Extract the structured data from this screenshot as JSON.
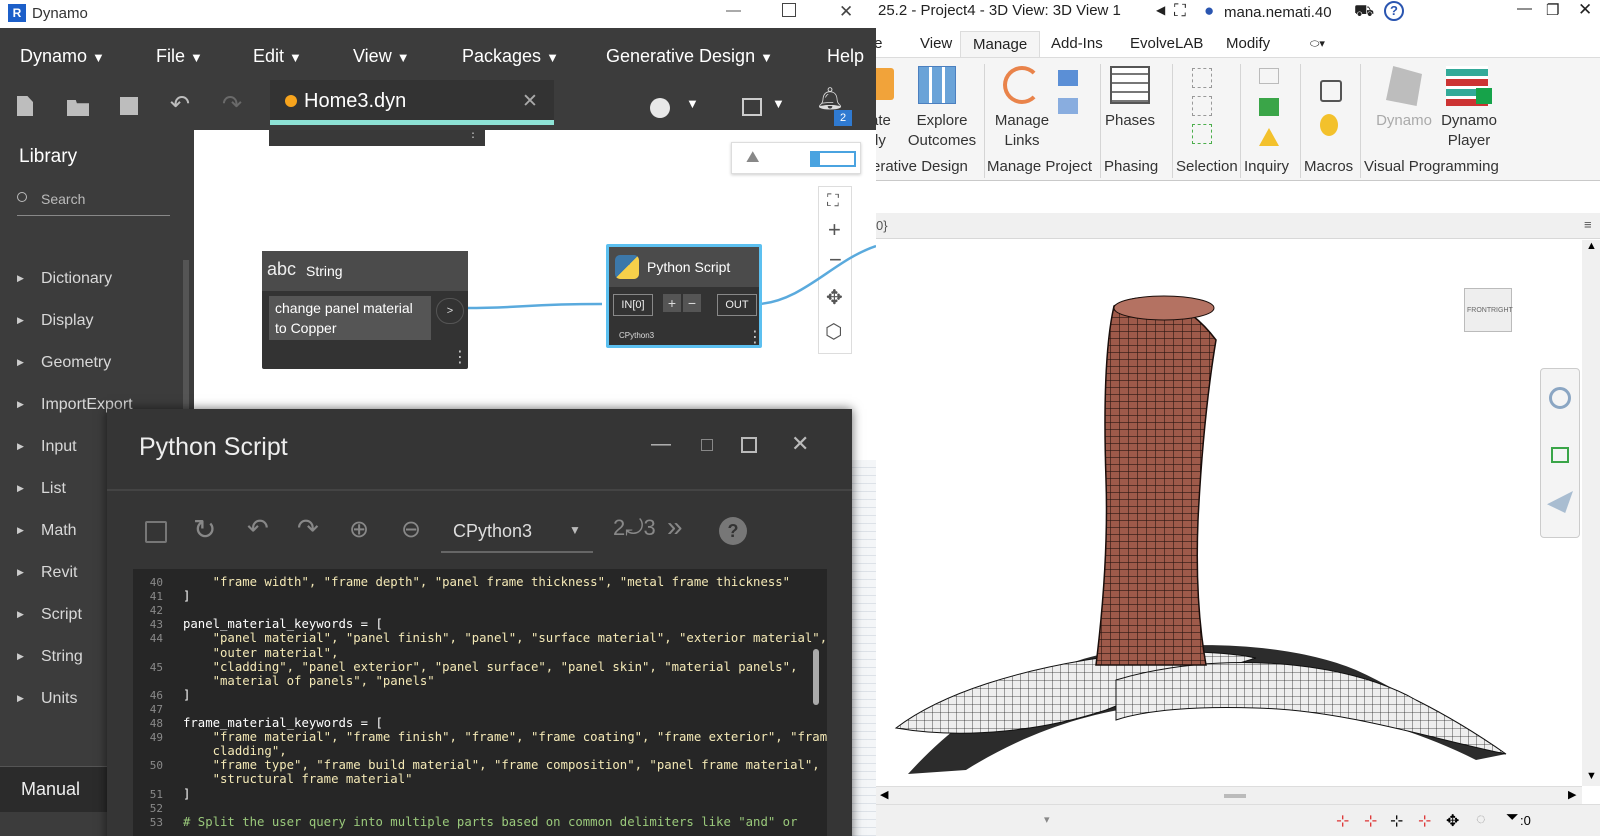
{
  "revit": {
    "title": "25.2 - Project4 - 3D View: 3D View 1",
    "user": "mana.nemati.40",
    "tabs": [
      "te",
      "View",
      "Manage",
      "Add-Ins",
      "EvolveLAB",
      "Modify"
    ],
    "active_tab": "Manage",
    "ribbon": {
      "items": [
        {
          "label": "ate\ndy"
        },
        {
          "label": "Explore\nOutcomes"
        },
        {
          "label": "Manage\nLinks"
        },
        {
          "label": "Phases"
        },
        {
          "label": "Dynamo"
        },
        {
          "label": "Dynamo\nPlayer"
        }
      ],
      "groups": [
        "erative Design",
        "Manage Project",
        "Phasing",
        "Selection",
        "Inquiry",
        "Macros",
        "Visual Programming"
      ]
    },
    "view_header": "0}",
    "viewcube": {
      "front": "FRONT",
      "right": "RIGHT"
    },
    "status_filter_count": ":0"
  },
  "dynamo": {
    "window_title": "Dynamo",
    "menu": [
      "Dynamo",
      "File",
      "Edit",
      "View",
      "Packages",
      "Generative Design",
      "Help"
    ],
    "tab_name": "Home3.dyn",
    "notification_count": "2",
    "library": {
      "title": "Library",
      "search_placeholder": "Search",
      "items": [
        "Dictionary",
        "Display",
        "Geometry",
        "ImportExport",
        "Input",
        "List",
        "Math",
        "Revit",
        "Script",
        "String",
        "Units"
      ],
      "manual": "Manual"
    },
    "string_node": {
      "icon_text": "abc",
      "title": "String",
      "value": "change panel material\nto Copper",
      "out": ">"
    },
    "python_node": {
      "title": "Python Script",
      "in_port": "IN[0]",
      "out_port": "OUT",
      "engine": "CPython3",
      "plus": "+",
      "minus": "−"
    },
    "editor": {
      "title": "Python Script",
      "engine": "CPython3",
      "lines": [
        {
          "n": "40",
          "t": "    \"frame width\", \"frame depth\", \"panel frame thickness\", \"metal frame thickness\""
        },
        {
          "n": "41",
          "t": "]"
        },
        {
          "n": "42",
          "t": ""
        },
        {
          "n": "43",
          "t": "panel_material_keywords = ["
        },
        {
          "n": "44",
          "t": "    \"panel material\", \"panel finish\", \"panel\", \"surface material\", \"exterior material\","
        },
        {
          "n": "",
          "t": "    \"outer material\","
        },
        {
          "n": "45",
          "t": "    \"cladding\", \"panel exterior\", \"panel surface\", \"panel skin\", \"material panels\","
        },
        {
          "n": "",
          "t": "    \"material of panels\", \"panels\""
        },
        {
          "n": "46",
          "t": "]"
        },
        {
          "n": "47",
          "t": ""
        },
        {
          "n": "48",
          "t": "frame_material_keywords = ["
        },
        {
          "n": "49",
          "t": "    \"frame material\", \"frame finish\", \"frame\", \"frame coating\", \"frame exterior\", \"frame"
        },
        {
          "n": "",
          "t": "    cladding\","
        },
        {
          "n": "50",
          "t": "    \"frame type\", \"frame build material\", \"frame composition\", \"panel frame material\","
        },
        {
          "n": "",
          "t": "    \"structural frame material\""
        },
        {
          "n": "51",
          "t": "]"
        },
        {
          "n": "52",
          "t": ""
        },
        {
          "n": "53",
          "t": "# Split the user query into multiple parts based on common delimiters like \"and\" or"
        }
      ]
    }
  }
}
